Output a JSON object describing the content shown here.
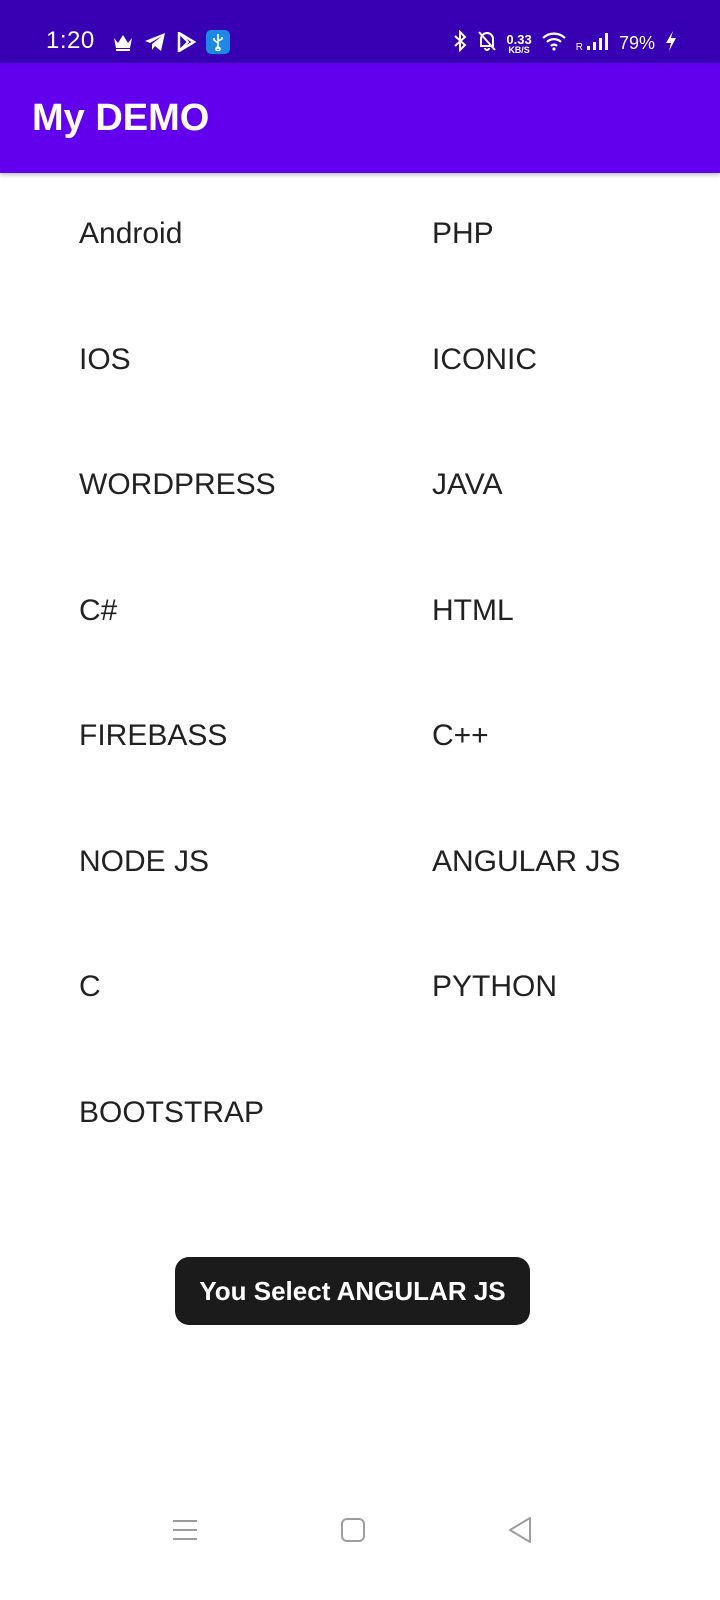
{
  "status_bar": {
    "time": "1:20",
    "net_speed_value": "0.33",
    "net_speed_unit": "KB/S",
    "roaming": "R",
    "battery": "79%",
    "icons_left": [
      "crown-icon",
      "telegram-icon",
      "play-store-icon",
      "usb-icon"
    ],
    "icons_right": [
      "bluetooth-icon",
      "bell-off-icon",
      "wifi-icon",
      "signal-icon",
      "charging-icon"
    ]
  },
  "app_bar": {
    "title": "My DEMO"
  },
  "grid": {
    "items": [
      "Android",
      "PHP",
      "IOS",
      "ICONIC",
      "WORDPRESS",
      "JAVA",
      "C#",
      "HTML",
      "FIREBASS",
      "C++",
      "NODE JS",
      "ANGULAR JS",
      "C",
      "PYTHON",
      "BOOTSTRAP"
    ]
  },
  "toast": {
    "message": "You Select ANGULAR JS"
  },
  "nav": {
    "buttons": [
      "menu-icon",
      "home-icon",
      "back-icon"
    ]
  },
  "colors": {
    "status_bar": "#3700b3",
    "app_bar": "#6200ee",
    "toast_bg": "#1b1b1b",
    "text": "#212121"
  }
}
